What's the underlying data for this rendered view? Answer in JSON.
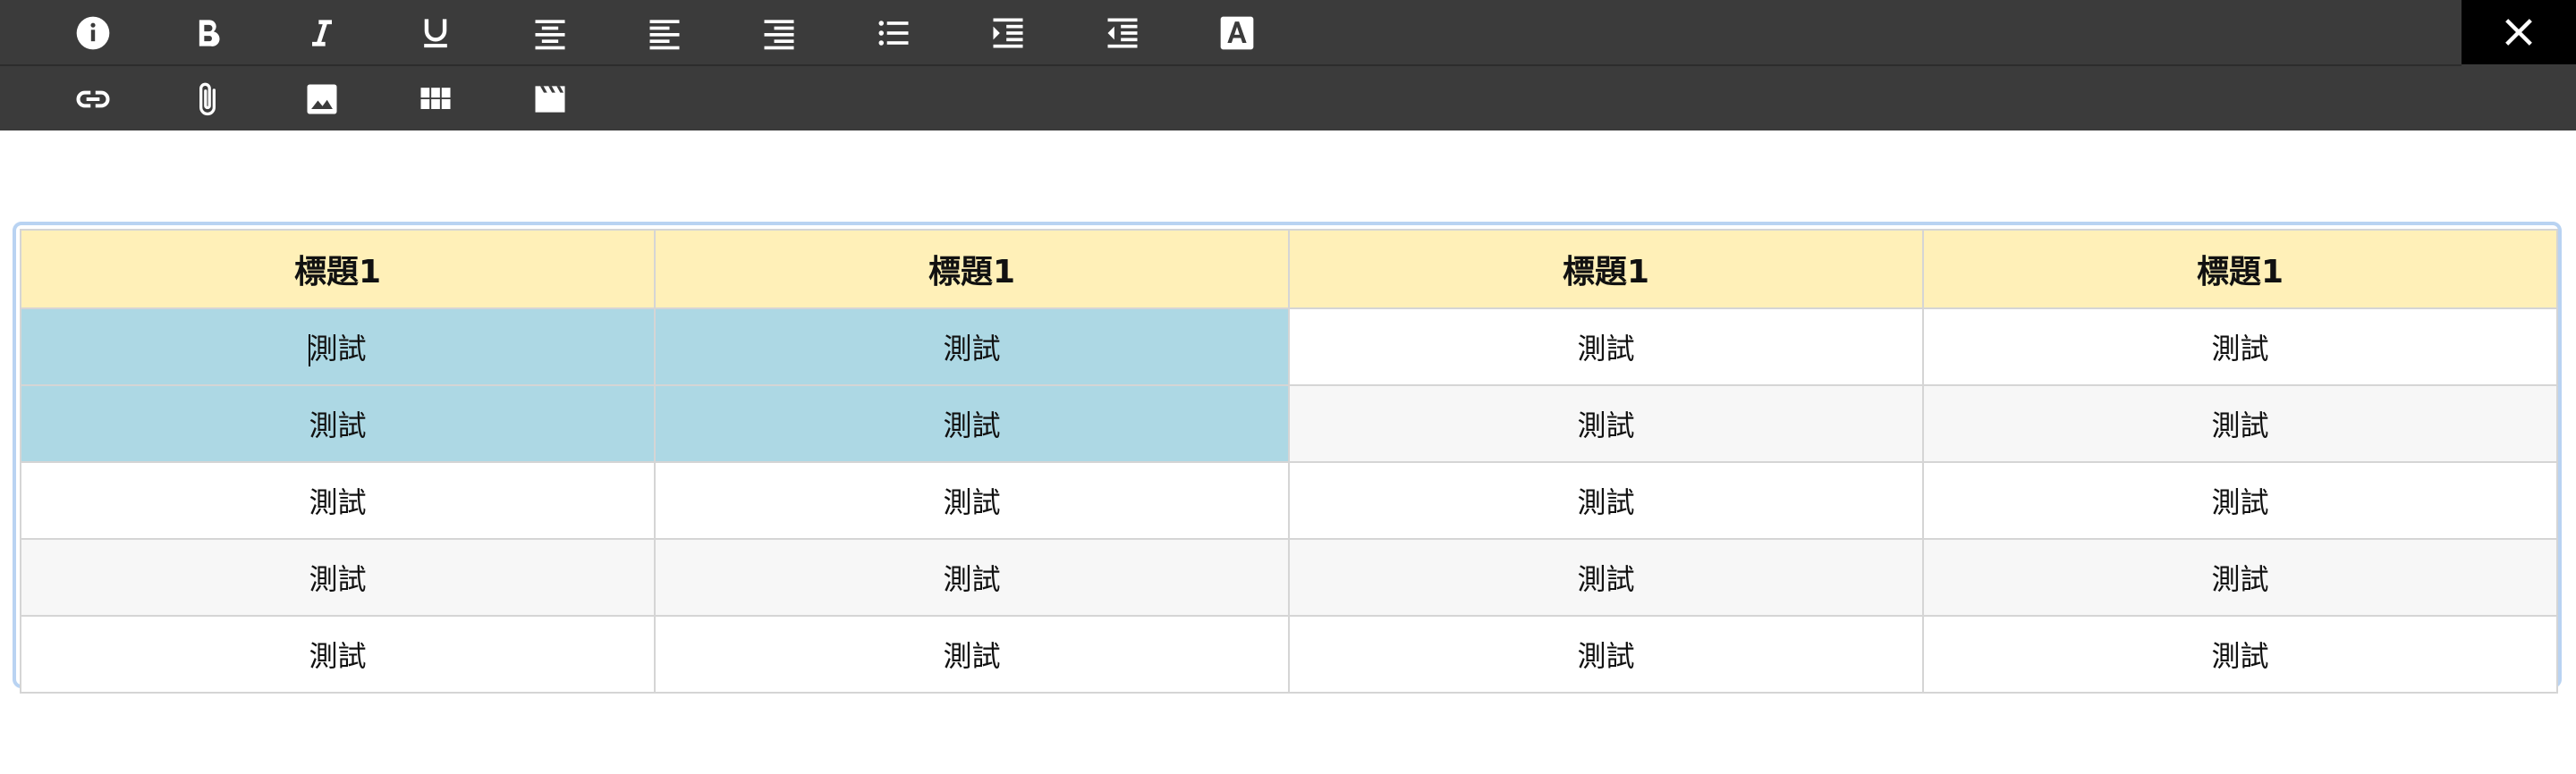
{
  "toolbar": {
    "row1": [
      {
        "name": "info-icon",
        "title": "info"
      },
      {
        "name": "bold-icon",
        "title": "bold"
      },
      {
        "name": "italic-icon",
        "title": "italic"
      },
      {
        "name": "underline-icon",
        "title": "underline"
      },
      {
        "name": "align-center-icon",
        "title": "align center"
      },
      {
        "name": "align-left-icon",
        "title": "align left"
      },
      {
        "name": "align-right-icon",
        "title": "align right"
      },
      {
        "name": "bulleted-list-icon",
        "title": "bulleted list"
      },
      {
        "name": "indent-icon",
        "title": "indent"
      },
      {
        "name": "outdent-icon",
        "title": "outdent"
      },
      {
        "name": "text-color-icon",
        "title": "text color"
      }
    ],
    "row2": [
      {
        "name": "link-icon",
        "title": "link"
      },
      {
        "name": "attachment-icon",
        "title": "attachment"
      },
      {
        "name": "image-icon",
        "title": "image"
      },
      {
        "name": "table-icon",
        "title": "table"
      },
      {
        "name": "video-icon",
        "title": "video"
      }
    ],
    "close": {
      "name": "close-icon"
    },
    "colors": {
      "background": "#3b3b3b",
      "icon": "#ffffff",
      "close_bg": "#000000"
    }
  },
  "table": {
    "headers": [
      "標題1",
      "標題1",
      "標題1",
      "標題1"
    ],
    "rows": [
      [
        "測試",
        "測試",
        "測試",
        "測試"
      ],
      [
        "測試",
        "測試",
        "測試",
        "測試"
      ],
      [
        "測試",
        "測試",
        "測試",
        "測試"
      ],
      [
        "測試",
        "測試",
        "測試",
        "測試"
      ],
      [
        "測試",
        "測試",
        "測試",
        "測試"
      ]
    ],
    "colors": {
      "header_bg": "#fff0b8",
      "selected_bg": "#add8e4",
      "border": "#b9d3f2"
    }
  }
}
